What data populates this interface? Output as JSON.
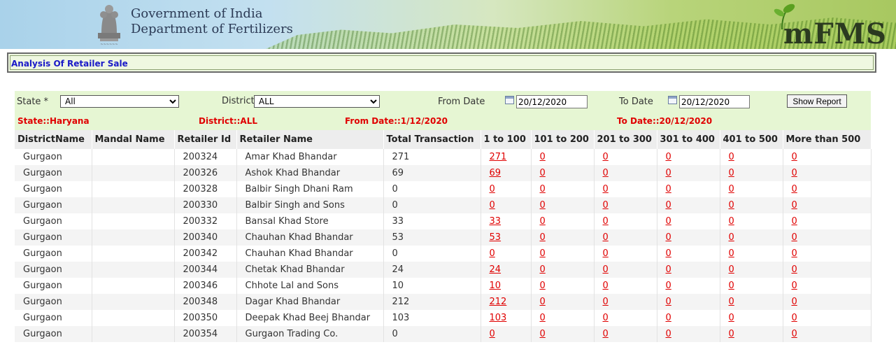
{
  "header": {
    "line1": "Government of India",
    "line2": "Department of Fertilizers",
    "logo": "mFMS",
    "emblem_icon": "national-emblem-icon"
  },
  "page_title": "Analysis Of Retailer Sale",
  "filters": {
    "state_label": "State *",
    "state_value": "All",
    "district_label": "District",
    "district_value": "ALL",
    "from_label": "From Date",
    "from_value": "20/12/2020",
    "to_label": "To Date",
    "to_value": "20/12/2020",
    "show_button": "Show Report"
  },
  "summary": {
    "state": "State::Haryana",
    "district": "District::ALL",
    "from": "From Date::1/12/2020",
    "to": "To Date::20/12/2020"
  },
  "table": {
    "columns": [
      "DistrictName",
      "Mandal Name",
      "Retailer Id",
      "Retailer Name",
      "Total Transaction",
      "1 to 100",
      "101 to 200",
      "201 to 300",
      "301 to 400",
      "401 to 500",
      "More than 500"
    ],
    "rows": [
      [
        "Gurgaon",
        "",
        "200324",
        "Amar Khad Bhandar",
        "271",
        "271",
        "0",
        "0",
        "0",
        "0",
        "0"
      ],
      [
        "Gurgaon",
        "",
        "200326",
        "Ashok Khad Bhandar",
        "69",
        "69",
        "0",
        "0",
        "0",
        "0",
        "0"
      ],
      [
        "Gurgaon",
        "",
        "200328",
        "Balbir Singh Dhani Ram",
        "0",
        "0",
        "0",
        "0",
        "0",
        "0",
        "0"
      ],
      [
        "Gurgaon",
        "",
        "200330",
        "Balbir Singh and Sons",
        "0",
        "0",
        "0",
        "0",
        "0",
        "0",
        "0"
      ],
      [
        "Gurgaon",
        "",
        "200332",
        "Bansal Khad Store",
        "33",
        "33",
        "0",
        "0",
        "0",
        "0",
        "0"
      ],
      [
        "Gurgaon",
        "",
        "200340",
        "Chauhan Khad Bhandar",
        "53",
        "53",
        "0",
        "0",
        "0",
        "0",
        "0"
      ],
      [
        "Gurgaon",
        "",
        "200342",
        "Chauhan Khad Bhandar",
        "0",
        "0",
        "0",
        "0",
        "0",
        "0",
        "0"
      ],
      [
        "Gurgaon",
        "",
        "200344",
        "Chetak Khad Bhandar",
        "24",
        "24",
        "0",
        "0",
        "0",
        "0",
        "0"
      ],
      [
        "Gurgaon",
        "",
        "200346",
        "Chhote Lal and Sons",
        "10",
        "10",
        "0",
        "0",
        "0",
        "0",
        "0"
      ],
      [
        "Gurgaon",
        "",
        "200348",
        "Dagar Khad Bhandar",
        "212",
        "212",
        "0",
        "0",
        "0",
        "0",
        "0"
      ],
      [
        "Gurgaon",
        "",
        "200350",
        "Deepak Khad Beej Bhandar",
        "103",
        "103",
        "0",
        "0",
        "0",
        "0",
        "0"
      ],
      [
        "Gurgaon",
        "",
        "200354",
        "Gurgaon Trading Co.",
        "0",
        "0",
        "0",
        "0",
        "0",
        "0",
        "0"
      ]
    ]
  }
}
